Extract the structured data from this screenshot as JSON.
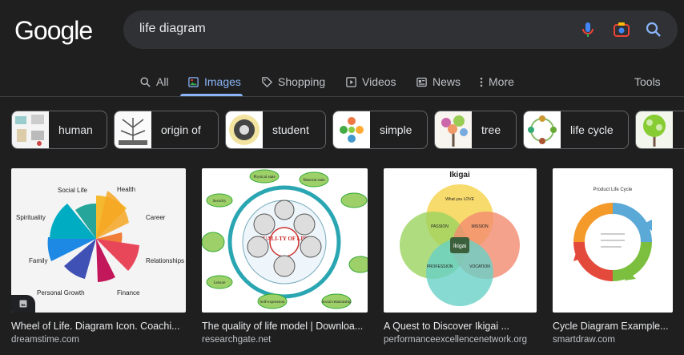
{
  "logo": "Google",
  "search": {
    "query": "life diagram"
  },
  "tabs": [
    {
      "label": "All",
      "icon": "search-icon"
    },
    {
      "label": "Images",
      "icon": "image-icon",
      "active": true
    },
    {
      "label": "Shopping",
      "icon": "tag-icon"
    },
    {
      "label": "Videos",
      "icon": "play-icon"
    },
    {
      "label": "News",
      "icon": "news-icon"
    },
    {
      "label": "More",
      "icon": "more-vert-icon"
    }
  ],
  "tools_label": "Tools",
  "chips": [
    "human",
    "origin of",
    "student",
    "simple",
    "tree",
    "life cycle"
  ],
  "results": [
    {
      "title": "Wheel of Life. Diagram Icon. Coachi...",
      "source": "dreamstime.com",
      "labels": [
        "Social Life",
        "Health",
        "Spirituality",
        "Career",
        "Family",
        "Relationships",
        "Personal Growth",
        "Finance"
      ]
    },
    {
      "title": "The quality of life model | Downloa...",
      "source": "researchgate.net",
      "labels": [
        "Physical state",
        "Material state",
        "Security",
        "Psycholog-ical state",
        "Environ-mental",
        "Education",
        "Leisure",
        "Self-expression",
        "Social relationship",
        "QUALI-TY OF LIFE"
      ]
    },
    {
      "title": "A Quest to Discover Ikigai ...",
      "source": "performanceexcellencenetwork.org",
      "labels": [
        "Ikigai",
        "PASSION",
        "MISSION",
        "PROFESSION",
        "VOCATION",
        "What you LOVE",
        "What you are GOOD AT",
        "What the world NEEDS",
        "What you can be PAID FOR"
      ]
    },
    {
      "title": "Cycle Diagram Example...",
      "source": "smartdraw.com",
      "labels": [
        "Product Life Cycle"
      ]
    }
  ]
}
